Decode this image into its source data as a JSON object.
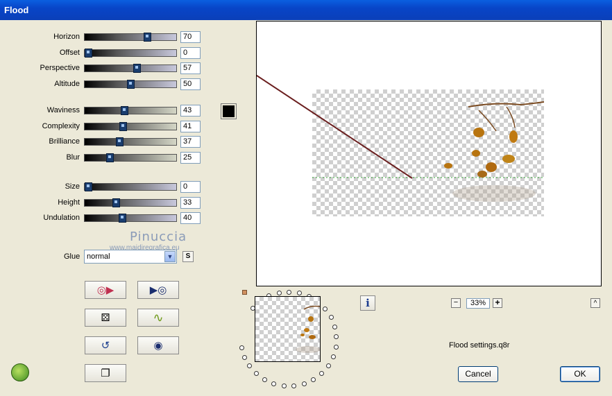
{
  "window": {
    "title": "Flood"
  },
  "sliders_group1": [
    {
      "label": "Horizon",
      "value": "70",
      "fill": 0.7
    },
    {
      "label": "Offset",
      "value": "0",
      "fill": 0.0
    },
    {
      "label": "Perspective",
      "value": "57",
      "fill": 0.57
    },
    {
      "label": "Altitude",
      "value": "50",
      "fill": 0.5
    }
  ],
  "sliders_group2": [
    {
      "label": "Waviness",
      "value": "43",
      "fill": 0.43
    },
    {
      "label": "Complexity",
      "value": "41",
      "fill": 0.41
    },
    {
      "label": "Brilliance",
      "value": "37",
      "fill": 0.37
    },
    {
      "label": "Blur",
      "value": "25",
      "fill": 0.25
    }
  ],
  "sliders_group3": [
    {
      "label": "Size",
      "value": "0",
      "fill": 0.0
    },
    {
      "label": "Height",
      "value": "33",
      "fill": 0.33
    },
    {
      "label": "Undulation",
      "value": "40",
      "fill": 0.4
    }
  ],
  "watermark": {
    "name": "Pinuccia",
    "site": "www.maidiregrafica.eu"
  },
  "glue": {
    "label": "Glue",
    "value": "normal",
    "s_button": "S"
  },
  "zoom": {
    "value": "33%",
    "minus": "−",
    "plus": "+"
  },
  "info_button": "i",
  "collapse_button": "^",
  "settings_file": "Flood settings.q8r",
  "buttons": {
    "cancel": "Cancel",
    "ok": "OK"
  },
  "colors": {
    "swatch": "#000000",
    "horizon_line": "#6a1e1e",
    "titlebar": "#0a5fe0"
  }
}
